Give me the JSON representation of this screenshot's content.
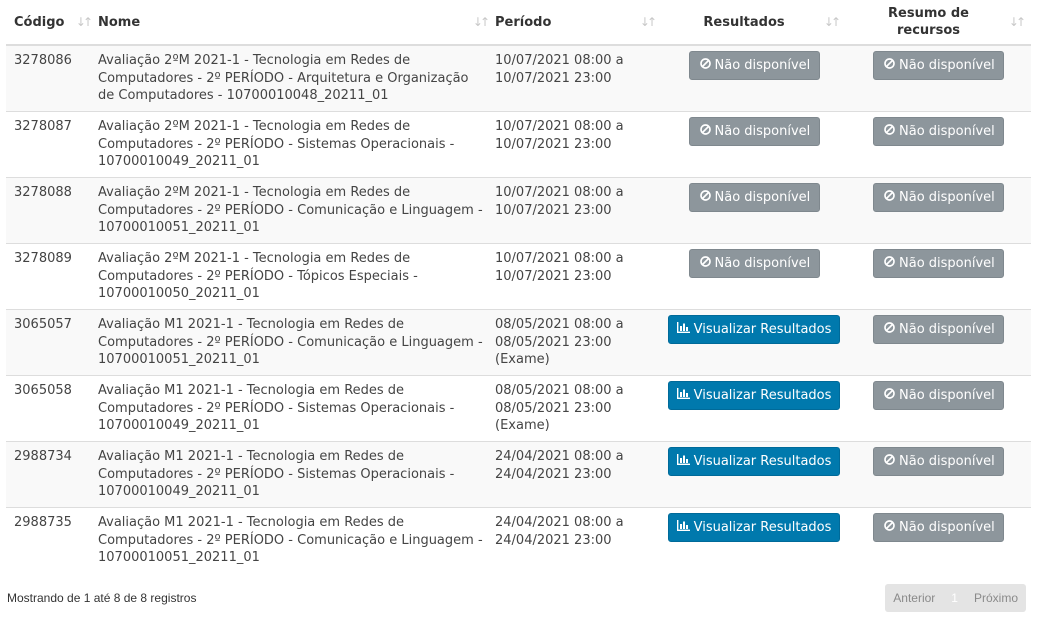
{
  "table": {
    "headers": {
      "codigo": "Código",
      "nome": "Nome",
      "periodo": "Período",
      "resultados": "Resultados",
      "resumo": "Resumo de recursos"
    },
    "rows": [
      {
        "codigo": "3278086",
        "nome": "Avaliação 2ºM 2021-1 - Tecnologia em Redes de Computadores - 2º PERÍODO - Arquitetura e Organização de Computadores - 10700010048_20211_01",
        "periodo": "10/07/2021 08:00 a 10/07/2021 23:00",
        "resultado": "Não disponível",
        "resumo": "Não disponível"
      },
      {
        "codigo": "3278087",
        "nome": "Avaliação 2ºM 2021-1 - Tecnologia em Redes de Computadores - 2º PERÍODO - Sistemas Operacionais - 10700010049_20211_01",
        "periodo": "10/07/2021 08:00 a 10/07/2021 23:00",
        "resultado": "Não disponível",
        "resumo": "Não disponível"
      },
      {
        "codigo": "3278088",
        "nome": "Avaliação 2ºM 2021-1 - Tecnologia em Redes de Computadores - 2º PERÍODO - Comunicação e Linguagem - 10700010051_20211_01",
        "periodo": "10/07/2021 08:00 a 10/07/2021 23:00",
        "resultado": "Não disponível",
        "resumo": "Não disponível"
      },
      {
        "codigo": "3278089",
        "nome": "Avaliação 2ºM 2021-1 - Tecnologia em Redes de Computadores - 2º PERÍODO - Tópicos Especiais - 10700010050_20211_01",
        "periodo": "10/07/2021 08:00 a 10/07/2021 23:00",
        "resultado": "Não disponível",
        "resumo": "Não disponível"
      },
      {
        "codigo": "3065057",
        "nome": "Avaliação M1 2021-1 - Tecnologia em Redes de Computadores - 2º PERÍODO - Comunicação e Linguagem - 10700010051_20211_01",
        "periodo": "08/05/2021 08:00 a 08/05/2021 23:00 (Exame)",
        "resultado": "Visualizar Resultados",
        "resumo": "Não disponível"
      },
      {
        "codigo": "3065058",
        "nome": "Avaliação M1 2021-1 - Tecnologia em Redes de Computadores - 2º PERÍODO - Sistemas Operacionais - 10700010049_20211_01",
        "periodo": "08/05/2021 08:00 a 08/05/2021 23:00 (Exame)",
        "resultado": "Visualizar Resultados",
        "resumo": "Não disponível"
      },
      {
        "codigo": "2988734",
        "nome": "Avaliação M1 2021-1 - Tecnologia em Redes de Computadores - 2º PERÍODO - Sistemas Operacionais - 10700010049_20211_01",
        "periodo": "24/04/2021 08:00 a 24/04/2021 23:00",
        "resultado": "Visualizar Resultados",
        "resumo": "Não disponível"
      },
      {
        "codigo": "2988735",
        "nome": "Avaliação M1 2021-1 - Tecnologia em Redes de Computadores - 2º PERÍODO - Comunicação e Linguagem - 10700010051_20211_01",
        "periodo": "24/04/2021 08:00 a 24/04/2021 23:00",
        "resultado": "Visualizar Resultados",
        "resumo": "Não disponível"
      }
    ]
  },
  "footer": {
    "info": "Mostrando de 1 até 8 de 8 registros",
    "prev": "Anterior",
    "page": "1",
    "next": "Próximo"
  },
  "icons": {
    "sort": "sort-icon",
    "unavailable": "ban-icon",
    "results": "bar-chart-icon"
  },
  "colors": {
    "disabled_button": "#8d969c",
    "primary_button": "#0079ad",
    "stripe": "#f9f9f9"
  }
}
